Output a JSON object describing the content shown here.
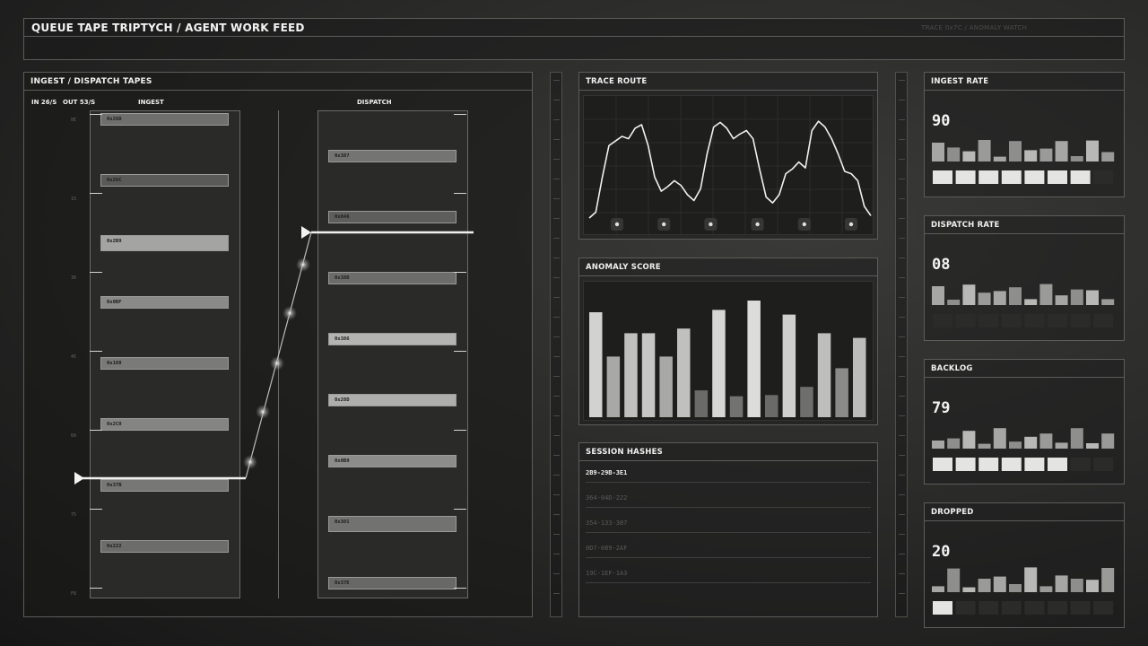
{
  "header": {
    "title": "QUEUE TAPE TRIPTYCH / AGENT WORK FEED",
    "subtitle": "TRACE 0x7C / ANOMALY WATCH"
  },
  "tapes": {
    "title": "INGEST / DISPATCH TAPES",
    "rate_in": "IN 26/S",
    "rate_out": "OUT 53/S",
    "ingest_label": "INGEST",
    "dispatch_label": "DISPATCH",
    "scale_ticks": [
      "0E",
      "15",
      "30",
      "45",
      "60",
      "75",
      "F8"
    ],
    "ingest_cells": [
      {
        "label": "0x26D",
        "shade": "#6f6f6d"
      },
      {
        "label": "0x26C",
        "shade": "#5a5a58"
      },
      {
        "label": "0x2B9",
        "shade": "#a4a4a2"
      },
      {
        "label": "0x0BF",
        "shade": "#8a8a88"
      },
      {
        "label": "0x108",
        "shade": "#7a7a78"
      },
      {
        "label": "0x2C0",
        "shade": "#848482"
      },
      {
        "label": "0x37B",
        "shade": "#777775"
      },
      {
        "label": "0x222",
        "shade": "#6c6c6a"
      }
    ],
    "dispatch_cells": [
      {
        "label": "0x387",
        "shade": "#747472"
      },
      {
        "label": "0x046",
        "shade": "#5e5e5c"
      },
      {
        "label": "0x38D",
        "shade": "#6c6c6a"
      },
      {
        "label": "0x386",
        "shade": "#b4b4b2"
      },
      {
        "label": "0x28D",
        "shade": "#aeaeac"
      },
      {
        "label": "0x0B9",
        "shade": "#8c8c8a"
      },
      {
        "label": "0x301",
        "shade": "#727270"
      },
      {
        "label": "0x37E",
        "shade": "#686866"
      }
    ]
  },
  "trace": {
    "title": "TRACE ROUTE",
    "series": [
      0.2,
      0.25,
      0.55,
      0.82,
      0.86,
      0.9,
      0.88,
      0.97,
      1.0,
      0.82,
      0.55,
      0.43,
      0.47,
      0.52,
      0.48,
      0.4,
      0.35,
      0.45,
      0.75,
      0.98,
      1.02,
      0.97,
      0.88,
      0.92,
      0.95,
      0.88,
      0.62,
      0.38,
      0.33,
      0.4,
      0.58,
      0.62,
      0.68,
      0.63,
      0.95,
      1.03,
      0.98,
      0.88,
      0.75,
      0.6,
      0.58,
      0.52,
      0.3,
      0.22
    ]
  },
  "anomaly": {
    "title": "ANOMALY SCORE",
    "bars": [
      {
        "v": 0.9,
        "shade": "#d2d2d0"
      },
      {
        "v": 0.52,
        "shade": "#a8a8a6"
      },
      {
        "v": 0.72,
        "shade": "#c0c0be"
      },
      {
        "v": 0.72,
        "shade": "#c6c6c4"
      },
      {
        "v": 0.52,
        "shade": "#a8a8a6"
      },
      {
        "v": 0.76,
        "shade": "#c0c0be"
      },
      {
        "v": 0.23,
        "shade": "#6a6a68"
      },
      {
        "v": 0.92,
        "shade": "#d6d6d4"
      },
      {
        "v": 0.18,
        "shade": "#727270"
      },
      {
        "v": 1.0,
        "shade": "#dcdcda"
      },
      {
        "v": 0.19,
        "shade": "#6a6a68"
      },
      {
        "v": 0.88,
        "shade": "#cfcfcd"
      },
      {
        "v": 0.26,
        "shade": "#6e6e6c"
      },
      {
        "v": 0.72,
        "shade": "#bebebc"
      },
      {
        "v": 0.42,
        "shade": "#8a8a88"
      },
      {
        "v": 0.68,
        "shade": "#bcbcba"
      }
    ]
  },
  "hashes": {
    "title": "SESSION HASHES",
    "rows": [
      {
        "text": "2B9-29B-3E1",
        "bright": true
      },
      {
        "text": "364-04D-222",
        "bright": false
      },
      {
        "text": "354-133-387",
        "bright": false
      },
      {
        "text": "0D7-089-2AF",
        "bright": false
      },
      {
        "text": "19C-1EF-1A3",
        "bright": false
      }
    ]
  },
  "metrics": [
    {
      "title": "INGEST RATE",
      "value": "90",
      "bars": [
        0.7,
        0.52,
        0.38,
        0.8,
        0.18,
        0.76,
        0.42,
        0.48,
        0.76,
        0.2,
        0.78,
        0.35
      ],
      "pips_on": 7,
      "pips_total": 8
    },
    {
      "title": "DISPATCH RATE",
      "value": "08",
      "bars": [
        0.7,
        0.2,
        0.76,
        0.46,
        0.52,
        0.66,
        0.22,
        0.78,
        0.36,
        0.58,
        0.55,
        0.22
      ],
      "pips_on": 0,
      "pips_total": 8
    },
    {
      "title": "BACKLOG",
      "value": "79",
      "bars": [
        0.3,
        0.38,
        0.66,
        0.18,
        0.76,
        0.26,
        0.44,
        0.56,
        0.22,
        0.76,
        0.2,
        0.56
      ],
      "pips_on": 6,
      "pips_total": 8
    },
    {
      "title": "DROPPED",
      "value": "20",
      "bars": [
        0.22,
        0.88,
        0.18,
        0.5,
        0.58,
        0.3,
        0.92,
        0.22,
        0.62,
        0.5,
        0.46,
        0.9
      ],
      "pips_on": 1,
      "pips_total": 8
    }
  ]
}
